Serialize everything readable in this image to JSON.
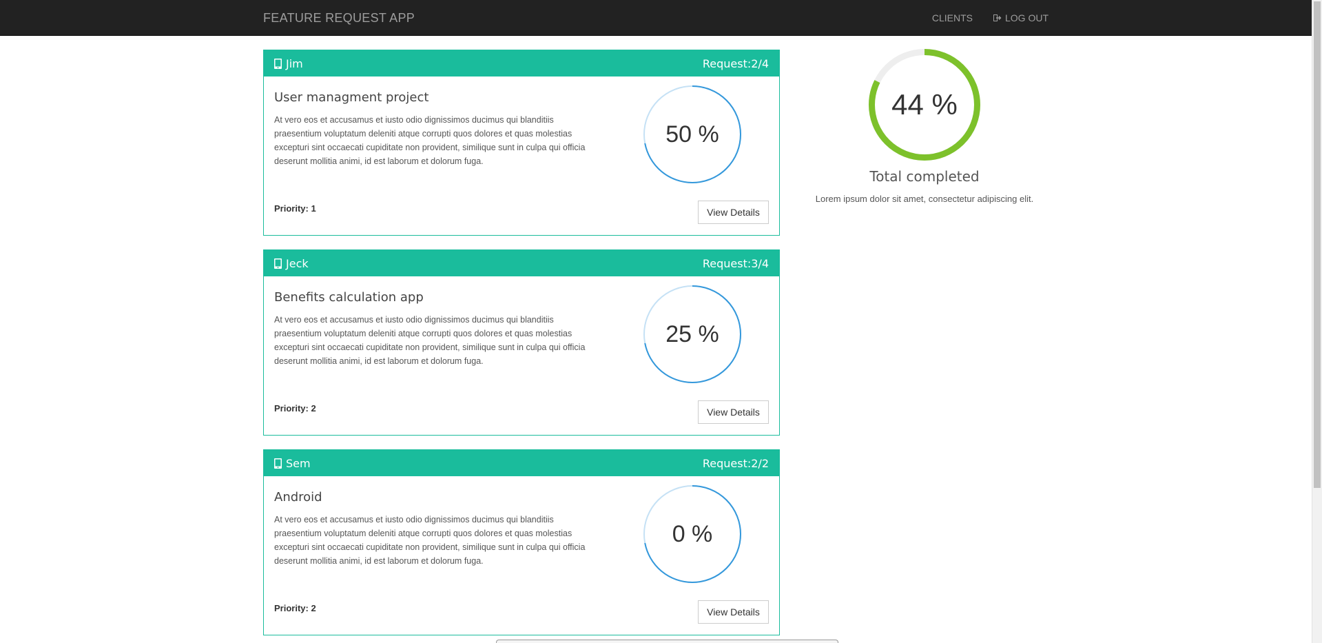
{
  "navbar": {
    "brand": "FEATURE REQUEST APP",
    "links": {
      "clients": "CLIENTS",
      "logout": "LOG OUT"
    }
  },
  "colors": {
    "navbar_bg": "#222222",
    "accent": "#1abc9c",
    "ring_blue": "#3498db",
    "ring_green": "#7dc12b"
  },
  "cards": [
    {
      "client": "Jim",
      "request": "Request:2/4",
      "title": "User managment project",
      "description": "At vero eos et accusamus et iusto odio dignissimos ducimus qui blanditiis praesentium voluptatum deleniti atque corrupti quos dolores et quas molestias excepturi sint occaecati cupiditate non provident, similique sunt in culpa qui officia deserunt mollitia animi, id est laborum et dolorum fuga.",
      "priority": "Priority: 1",
      "progress_text": "50 %",
      "progress": 0.5,
      "button": "View Details"
    },
    {
      "client": "Jeck",
      "request": "Request:3/4",
      "title": "Benefits calculation app",
      "description": "At vero eos et accusamus et iusto odio dignissimos ducimus qui blanditiis praesentium voluptatum deleniti atque corrupti quos dolores et quas molestias excepturi sint occaecati cupiditate non provident, similique sunt in culpa qui officia deserunt mollitia animi, id est laborum et dolorum fuga.",
      "priority": "Priority: 2",
      "progress_text": "25 %",
      "progress": 0.25,
      "button": "View Details"
    },
    {
      "client": "Sem",
      "request": "Request:2/2",
      "title": "Android",
      "description": "At vero eos et accusamus et iusto odio dignissimos ducimus qui blanditiis praesentium voluptatum deleniti atque corrupti quos dolores et quas molestias excepturi sint occaecati cupiditate non provident, similique sunt in culpa qui officia deserunt mollitia animi, id est laborum et dolorum fuga.",
      "priority": "Priority: 2",
      "progress_text": "0 %",
      "progress": 0,
      "button": "View Details"
    }
  ],
  "summary": {
    "progress_text": "44 %",
    "progress": 0.44,
    "title": "Total completed",
    "description": "Lorem ipsum dolor sit amet, consectetur adipiscing elit."
  }
}
